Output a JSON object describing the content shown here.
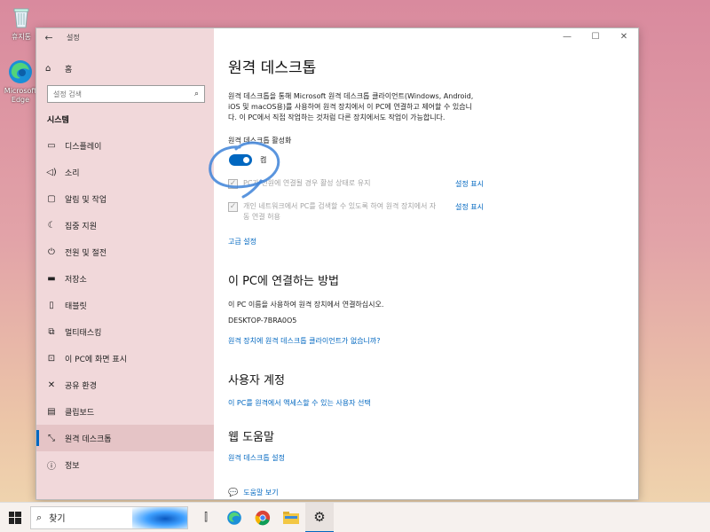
{
  "desktop": {
    "recycle_bin": "휴지통",
    "edge": "Microsoft Edge"
  },
  "window": {
    "title": "설정",
    "controls": {
      "minimize": "—",
      "maximize": "☐",
      "close": "✕"
    }
  },
  "sidebar": {
    "home": "홈",
    "search_placeholder": "설정 검색",
    "section": "시스템",
    "items": [
      {
        "label": "디스플레이",
        "icon": "display-icon"
      },
      {
        "label": "소리",
        "icon": "sound-icon"
      },
      {
        "label": "알림 및 작업",
        "icon": "notifications-icon"
      },
      {
        "label": "집중 지원",
        "icon": "focus-assist-icon"
      },
      {
        "label": "전원 및 절전",
        "icon": "power-icon"
      },
      {
        "label": "저장소",
        "icon": "storage-icon"
      },
      {
        "label": "태블릿",
        "icon": "tablet-icon"
      },
      {
        "label": "멀티태스킹",
        "icon": "multitasking-icon"
      },
      {
        "label": "이 PC에 화면 표시",
        "icon": "projecting-icon"
      },
      {
        "label": "공유 환경",
        "icon": "shared-experiences-icon"
      },
      {
        "label": "클립보드",
        "icon": "clipboard-icon"
      },
      {
        "label": "원격 데스크톱",
        "icon": "remote-desktop-icon",
        "active": true
      },
      {
        "label": "정보",
        "icon": "info-icon"
      }
    ]
  },
  "main": {
    "title": "원격 데스크톱",
    "description": "원격 데스크톱을 통해 Microsoft 원격 데스크톱 클라이언트(Windows, Android, iOS 및 macOS용)를 사용하여 원격 장치에서 이 PC에 연결하고 제어할 수 있습니다. 이 PC에서 직접 작업하는 것처럼 다른 장치에서도 작업이 가능합니다.",
    "enable_label": "원격 데스크톱 활성화",
    "enable_state": "켬",
    "checkboxes": [
      {
        "label": "PC가 전원에 연결될 경우 활성 상태로 유지",
        "link": "설정 표시"
      },
      {
        "label": "개인 네트워크에서 PC를 검색할 수 있도록 하여 원격 장치에서 자동 연결 허용",
        "link": "설정 표시"
      }
    ],
    "advanced_link": "고급 설정",
    "connect_heading": "이 PC에 연결하는 방법",
    "connect_text": "이 PC 이름을 사용하여 원격 장치에서 연결하십시오.",
    "pc_name": "DESKTOP-7BRA0O5",
    "no_client_link": "원격 장치에 원격 데스크톱 클라이언트가 없습니까?",
    "accounts_heading": "사용자 계정",
    "accounts_link": "이 PC를 원격에서 액세스할 수 있는 사용자 선택",
    "help_heading": "웹 도움말",
    "help_link": "원격 데스크톱 설정",
    "get_help": "도움말 보기"
  },
  "taskbar": {
    "search_text": "찾기",
    "colors": {
      "accent": "#0067c0"
    }
  }
}
